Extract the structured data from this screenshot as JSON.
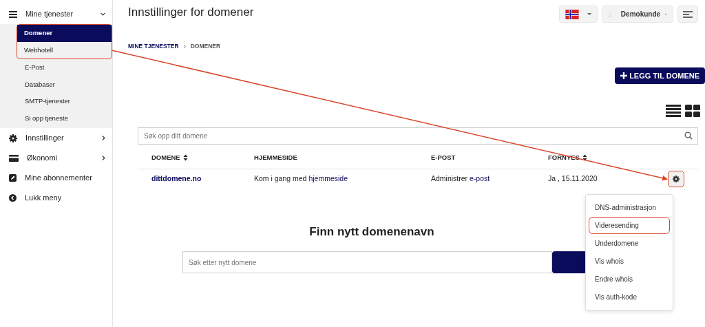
{
  "sidebar": {
    "items": [
      {
        "label": "Mine tjenester",
        "expanded": true,
        "children": [
          {
            "label": "Domener",
            "selected": true,
            "highlighted": true
          },
          {
            "label": "Webhotell",
            "selected": false,
            "highlighted": true
          },
          {
            "label": "E-Post",
            "selected": false,
            "highlighted": false
          },
          {
            "label": "Databaser",
            "selected": false,
            "highlighted": false
          },
          {
            "label": "SMTP-tjenester",
            "selected": false,
            "highlighted": false
          },
          {
            "label": "Si opp tjeneste",
            "selected": false,
            "highlighted": false
          }
        ]
      },
      {
        "label": "Innstillinger",
        "expanded": false
      },
      {
        "label": "Økonomi",
        "expanded": false
      },
      {
        "label": "Mine abonnementer"
      },
      {
        "label": "Lukk meny"
      }
    ]
  },
  "header": {
    "title": "Innstillinger for domener",
    "user": "Demokunde"
  },
  "breadcrumb": [
    "MINE TJENESTER",
    "DOMENER"
  ],
  "add_button": "LEGG TIL DOMENE",
  "search": {
    "placeholder": "Søk opp ditt domene"
  },
  "table": {
    "columns": [
      {
        "label": "DOMENE",
        "sortable": true
      },
      {
        "label": "HJEMMESIDE",
        "sortable": false
      },
      {
        "label": "E-POST",
        "sortable": false
      },
      {
        "label": "FORNYES",
        "sortable": true
      }
    ],
    "rows": [
      {
        "domain": "dittdomene.no",
        "homepage": {
          "text": "Kom i gang med",
          "link": "hjemmeside"
        },
        "email": {
          "text": "Administrer",
          "link": "e-post"
        },
        "renews": "Ja , 15.11.2020",
        "gear_highlighted": true
      }
    ]
  },
  "dropdown": {
    "items": [
      {
        "label": "DNS-administrasjon",
        "highlighted": false
      },
      {
        "label": "Videresending",
        "highlighted": true
      },
      {
        "label": "Underdomene",
        "highlighted": false
      },
      {
        "label": "Vis whois",
        "highlighted": false
      },
      {
        "label": "Endre whois",
        "highlighted": false
      },
      {
        "label": "Vis auth-kode",
        "highlighted": false
      }
    ]
  },
  "find": {
    "title": "Finn nytt domenenavn",
    "placeholder": "Søk etter nytt domene"
  }
}
